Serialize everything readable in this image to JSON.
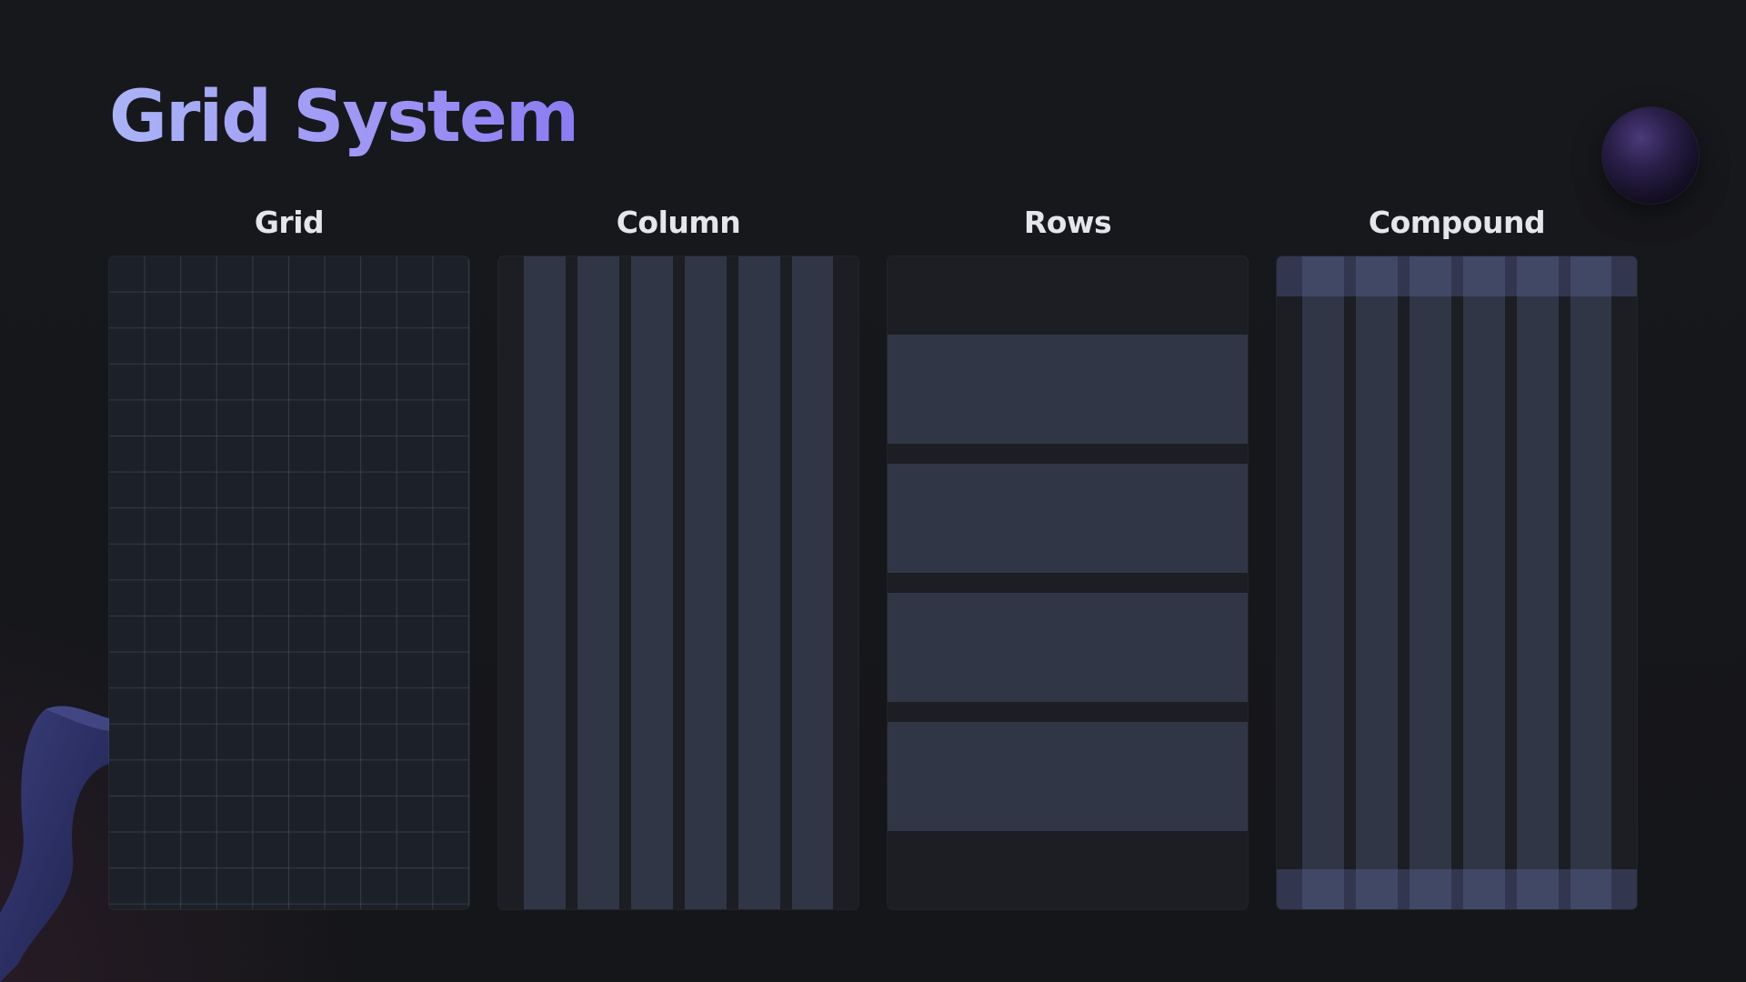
{
  "title": "Grid System",
  "columns": [
    {
      "label": "Grid"
    },
    {
      "label": "Column"
    },
    {
      "label": "Rows"
    },
    {
      "label": "Compound"
    }
  ],
  "colors": {
    "background": "#16171b",
    "panel": "#1c1e24",
    "stripe": "#303645",
    "title_gradient_start": "#aab4f6",
    "title_gradient_end": "#8b7cf2",
    "label": "#e4e6ec"
  }
}
